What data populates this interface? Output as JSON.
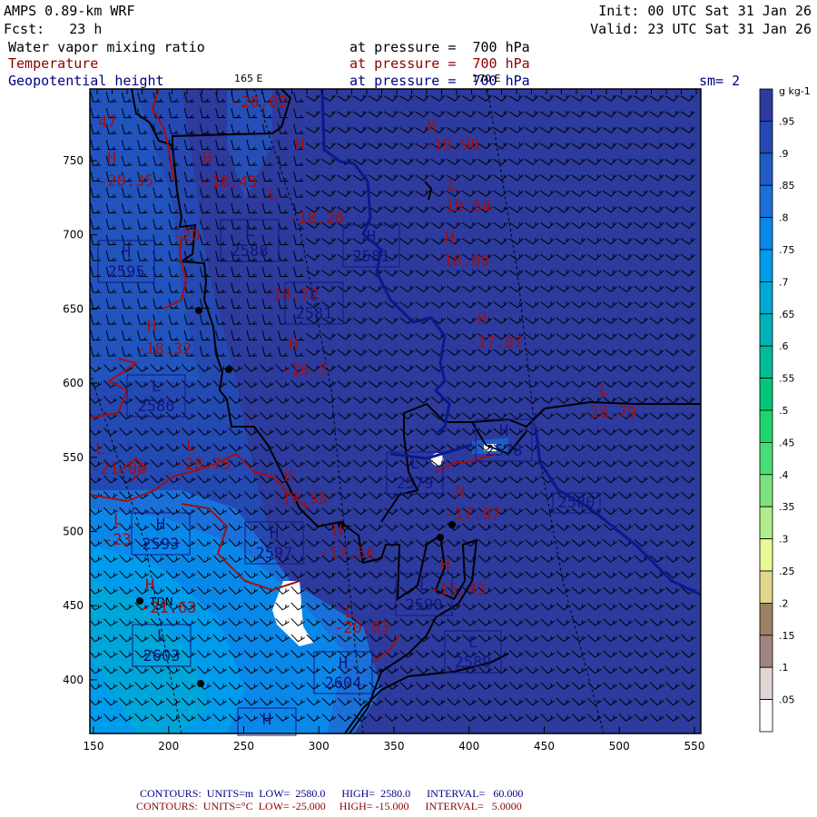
{
  "header": {
    "model": "AMPS 0.89-km WRF",
    "forecast": "Fcst:   23 h",
    "init": "Init: 00 UTC Sat 31 Jan 26",
    "valid": "Valid: 23 UTC Sat 31 Jan 26",
    "fields": [
      {
        "name": "Water vapor mixing ratio",
        "level": "at pressure =  700 hPa",
        "color": "#000000"
      },
      {
        "name": "Temperature",
        "level": "at pressure =  700 hPa",
        "color": "#8b0000"
      },
      {
        "name": "Geopotential height",
        "level": "at pressure =  700 hPa",
        "color": "#000080"
      }
    ],
    "smoothing": "sm= 2",
    "lon_labels": [
      "165 E",
      "170 E"
    ]
  },
  "axes": {
    "x_ticks": [
      "150",
      "200",
      "250",
      "300",
      "350",
      "400",
      "450",
      "500",
      "550"
    ],
    "y_ticks": [
      "750",
      "700",
      "650",
      "600",
      "550",
      "500",
      "450",
      "400"
    ]
  },
  "colorbar": {
    "units": "g kg-1",
    "labels": [
      ".95",
      ".9",
      ".85",
      ".8",
      ".75",
      ".7",
      ".65",
      ".6",
      ".55",
      ".5",
      ".45",
      ".4",
      ".35",
      ".3",
      ".25",
      ".2",
      ".15",
      ".1",
      ".05"
    ],
    "colors": [
      "#2d3a9e",
      "#2449b3",
      "#1f5cc6",
      "#1a70d8",
      "#0a88ea",
      "#009cec",
      "#00a8d4",
      "#00b2b8",
      "#00bc98",
      "#00c878",
      "#1ed46c",
      "#4adc78",
      "#7ce27e",
      "#b0ec8a",
      "#e8f894",
      "#e0d68c",
      "#9c8064",
      "#a08680",
      "#e0d6d4",
      "#ffffff"
    ]
  },
  "map": {
    "station": "TDN",
    "temp_labels": [
      "47",
      "H",
      "-20.35",
      "H",
      "-18.45",
      "-20",
      "-20.03",
      "H",
      "-18.26",
      "L",
      "-18.72",
      "H",
      "-18.32",
      "H",
      "-16.7",
      "H",
      "-18.98",
      "L",
      "-19.54",
      "H",
      "-18.89",
      "H",
      "-17.87",
      "L",
      "-16.79",
      "L",
      "-21.06",
      "L",
      "-20.75",
      "H",
      "-17.55",
      "H",
      "-17.56",
      "L",
      "-23",
      "H",
      "-21.63",
      "L",
      "-20.63",
      "H",
      "-17.97",
      "H",
      "-15.43"
    ],
    "height_boxes": [
      {
        "hl": "L",
        "value": "2588"
      },
      {
        "hl": "H",
        "value": "2581"
      },
      {
        "hl": "L",
        "value": "2581"
      },
      {
        "hl": "H",
        "value": "2595"
      },
      {
        "hl": "L",
        "value": "2586"
      },
      {
        "hl": "L",
        "value": "2579"
      },
      {
        "hl": "H",
        "value": "2578"
      },
      {
        "hl": "",
        "value": "2580"
      },
      {
        "hl": "H",
        "value": "2593"
      },
      {
        "hl": "H",
        "value": "2597"
      },
      {
        "hl": "L",
        "value": "2590"
      },
      {
        "hl": "L",
        "value": "2603"
      },
      {
        "hl": "H",
        "value": "2604"
      },
      {
        "hl": "L",
        "value": "2589"
      },
      {
        "hl": "H",
        "value": ""
      }
    ]
  },
  "footer": {
    "height": "CONTOURS:  UNITS=m  LOW=  2580.0      HIGH=  2580.0      INTERVAL=   60.000",
    "temp": "CONTOURS:  UNITS=°C  LOW= -25.000     HIGH= -15.000      INTERVAL=   5.0000"
  }
}
